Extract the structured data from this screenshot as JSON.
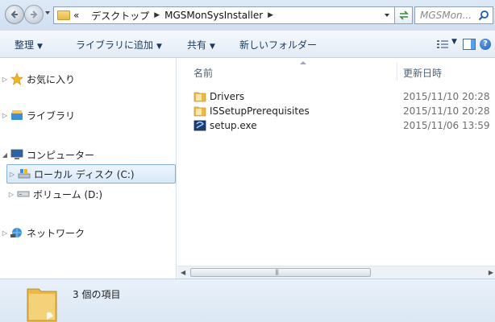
{
  "address": {
    "chevron": "«",
    "crumbs": [
      "デスクトップ",
      "MGSMonSysInstaller"
    ],
    "search_placeholder": "MGSMon..."
  },
  "toolbar": {
    "organize": "整理",
    "add_to_library": "ライブラリに追加",
    "share": "共有",
    "new_folder": "新しいフォルダー"
  },
  "nav": {
    "favorites": "お気に入り",
    "libraries": "ライブラリ",
    "computer": "コンピューター",
    "local_disk": "ローカル ディスク (C:)",
    "volume_d": "ボリューム (D:)",
    "network": "ネットワーク"
  },
  "columns": {
    "name": "名前",
    "date": "更新日時"
  },
  "files": [
    {
      "name": "Drivers",
      "date": "2015/11/10 20:28",
      "icon": "folder-icon"
    },
    {
      "name": "ISSetupPrerequisites",
      "date": "2015/11/10 20:28",
      "icon": "folder-icon"
    },
    {
      "name": "setup.exe",
      "date": "2015/11/06 13:59",
      "icon": "setup-exe-icon"
    }
  ],
  "details": {
    "item_count": "3 個の項目"
  },
  "colors": {
    "accent": "#84acdd",
    "selection": "#d7e9fb",
    "folder": "#e8b94a"
  }
}
